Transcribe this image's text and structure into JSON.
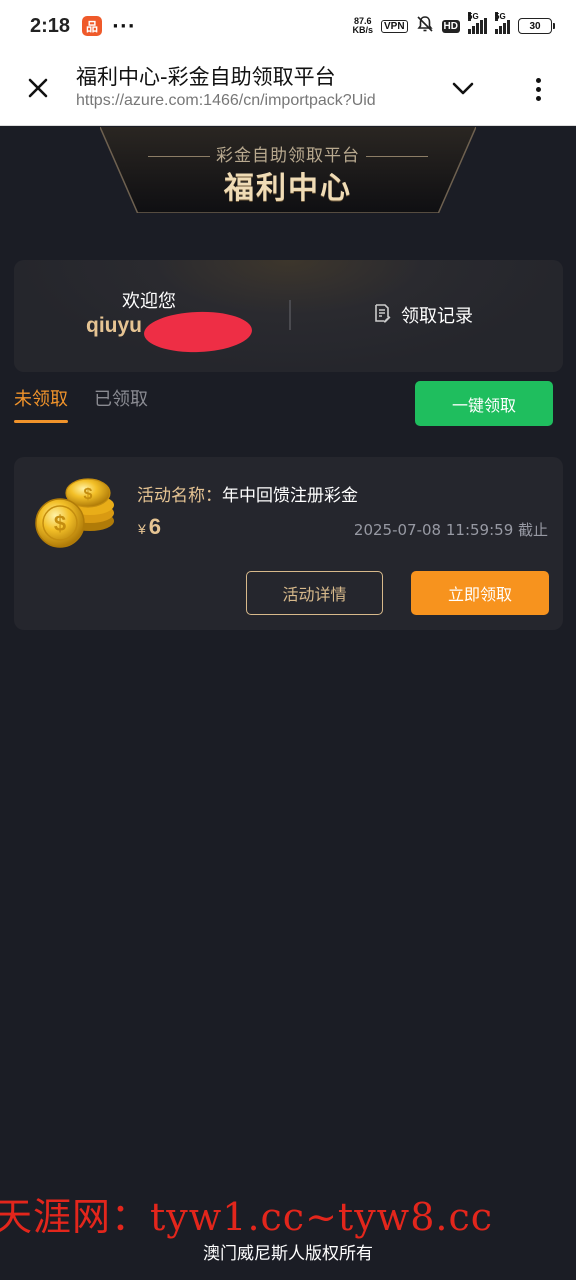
{
  "status_bar": {
    "time": "2:18",
    "app_icon_glyph": "品",
    "more": "···",
    "net_speed_value": "87.6",
    "net_speed_unit": "KB/s",
    "vpn": "VPN",
    "hd": "HD",
    "sig1_label": "5G",
    "sig2_label": "5G",
    "battery": "30"
  },
  "browser": {
    "title": "福利中心-彩金自助领取平台",
    "url": "https://azure.com:1466/cn/importpack?Uid"
  },
  "banner": {
    "subtitle": "彩金自助领取平台",
    "title": "福利中心"
  },
  "welcome": {
    "label": "欢迎您",
    "username": "qiuyu",
    "record_label": "领取记录"
  },
  "tabs": {
    "unclaimed": "未领取",
    "claimed": "已领取"
  },
  "one_click_label": "一键领取",
  "activity": {
    "name_key": "活动名称：",
    "name_value": "年中回馈注册彩金",
    "currency": "¥",
    "amount": "6",
    "deadline": "2025-07-08 11:59:59 截止",
    "detail_button": "活动详情",
    "claim_button": "立即领取"
  },
  "watermark": "天涯网：tyw1.cc~tyw8.cc",
  "copyright": "澳门威尼斯人版权所有",
  "colors": {
    "background": "#1b1d25",
    "gold": "#e6c493",
    "orange": "#f7931e",
    "green": "#1fbe5e",
    "watermark_red": "#e3261c"
  }
}
